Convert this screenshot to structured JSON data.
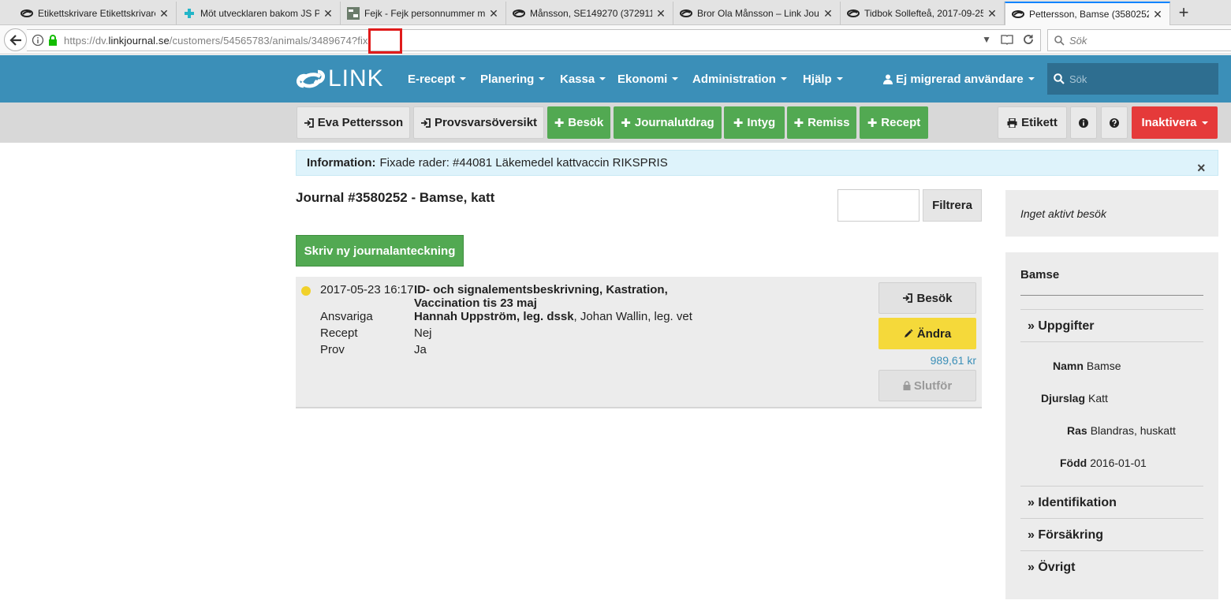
{
  "browser": {
    "tabs": [
      {
        "label": "Etikettskrivare Etikettskrivare",
        "icon": "link-cloud-icon"
      },
      {
        "label": "Möt utvecklaren bakom JS P",
        "icon": "puzzle-icon"
      },
      {
        "label": "Fejk - Fejk personnummer m",
        "icon": "fejk-icon"
      },
      {
        "label": "Månsson, SE149270 (372911",
        "icon": "link-cloud-icon"
      },
      {
        "label": "Bror Ola Månsson – Link Jou",
        "icon": "link-cloud-icon"
      },
      {
        "label": "Tidbok Sollefteå, 2017-09-25",
        "icon": "link-cloud-icon"
      },
      {
        "label": "Pettersson, Bamse (3580252)",
        "icon": "link-cloud-icon",
        "active": true
      }
    ],
    "url": {
      "prefix": "https://dv.",
      "domain": "linkjournal.se",
      "path": "/customers/54565783/animals/3489674?fix"
    },
    "search_placeholder": "Sök"
  },
  "app": {
    "logo": "LINK",
    "menu": [
      "E-recept",
      "Planering",
      "Kassa",
      "Ekonomi",
      "Administration",
      "Hjälp"
    ],
    "user": "Ej migrerad användare",
    "search_placeholder": "Sök"
  },
  "subnav": {
    "owner": "Eva Pettersson",
    "samples": "Provsvarsöversikt",
    "add_visit": "Besök",
    "add_extract": "Journalutdrag",
    "add_certificate": "Intyg",
    "add_referral": "Remiss",
    "add_prescription": "Recept",
    "label": "Etikett",
    "deactivate": "Inaktivera"
  },
  "alert": {
    "title": "Information:",
    "text": "Fixade rader: #44081 Läkemedel kattvaccin RIKSPRIS"
  },
  "journal": {
    "title": "Journal #3580252 - Bamse, katt",
    "filter_label": "Filtrera",
    "new_note": "Skriv ny journalanteckning"
  },
  "entry": {
    "date": "2017-05-23 16:17",
    "title": "ID- och signalementsbeskrivning, Kastration, Vaccination tis 23 maj",
    "responsible_label": "Ansvariga",
    "responsible_bold": "Hannah Uppström, leg. dssk",
    "responsible_rest": ", Johan Wallin, leg. vet",
    "prescription_label": "Recept",
    "prescription_value": "Nej",
    "sample_label": "Prov",
    "sample_value": "Ja",
    "visit_btn": "Besök",
    "edit_btn": "Ändra",
    "price": "989,61 kr",
    "finish_btn": "Slutför"
  },
  "sidebar": {
    "visit_status": "Inget aktivt besök",
    "animal_name": "Bamse",
    "section_details": "» Uppgifter",
    "name_label": "Namn",
    "name_value": "Bamse",
    "species_label": "Djurslag",
    "species_value": "Katt",
    "breed_label": "Ras",
    "breed_value": "Blandras, huskatt",
    "born_label": "Född",
    "born_value": "2016-01-01",
    "section_identification": "» Identifikation",
    "section_insurance": "» Försäkring",
    "section_other": "» Övrigt"
  },
  "colors": {
    "brand": "#3b8fb8",
    "green": "#52a952",
    "red": "#e53a3a",
    "yellow": "#f5d93a",
    "alert_bg": "#def3fb",
    "highlight": "#e01b1b"
  }
}
